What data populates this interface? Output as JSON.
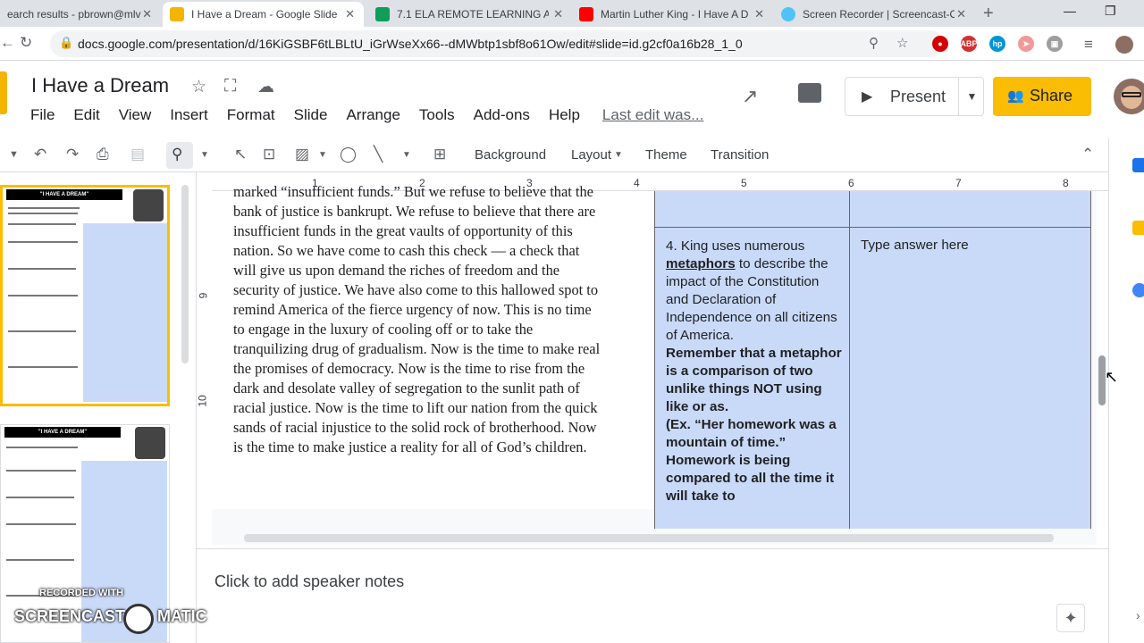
{
  "browser": {
    "tabs": [
      {
        "title": "earch results - pbrown@mlv",
        "color": "#1a73e8"
      },
      {
        "title": "I Have a Dream - Google Slide",
        "color": "#f4b400"
      },
      {
        "title": "7.1 ELA REMOTE LEARNING A",
        "color": "#0f9d58"
      },
      {
        "title": "Martin Luther King - I Have A D",
        "color": "#ff0000"
      },
      {
        "title": "Screen Recorder | Screencast-O",
        "color": "#4fc3f7"
      }
    ],
    "url": "docs.google.com/presentation/d/16KiGSBF6tLBLtU_iGrWseXx66--dMWbtp1sbf8o61Ow/edit#slide=id.g2cf0a16b28_1_0",
    "extensions": [
      "ABP",
      "hp"
    ]
  },
  "doc": {
    "title": "I Have a Dream",
    "menu": [
      "File",
      "Edit",
      "View",
      "Insert",
      "Format",
      "Slide",
      "Arrange",
      "Tools",
      "Add-ons",
      "Help"
    ],
    "last_edit": "Last edit was...",
    "present_label": "Present",
    "share_label": "Share"
  },
  "toolbar": {
    "background": "Background",
    "layout": "Layout",
    "theme": "Theme",
    "transition": "Transition"
  },
  "ruler": [
    "1",
    "2",
    "3",
    "4",
    "5",
    "6",
    "7",
    "8"
  ],
  "vruler": [
    "9",
    "10"
  ],
  "filmstrip": {
    "slide1_title": "\"I HAVE A DREAM\"",
    "slide2_title": "\"I HAVE A DREAM\""
  },
  "slide": {
    "speech": "marked “insufficient funds.” But we refuse to believe that the\nbank of justice is bankrupt. We refuse to believe that there are\ninsufficient funds in the great vaults of opportunity of this\nnation. So we have come to cash this check — a check that\nwill give us upon demand the riches of freedom and the\nsecurity of justice. We have also come to this hallowed spot to\nremind America of the fierce urgency of now. This is no time\nto engage in the luxury of cooling off or to take the\ntranquilizing drug of gradualism. Now is the time to make real\nthe promises of democracy. Now is the time to rise from the\ndark and desolate valley of segregation to the sunlit path of\nracial justice. Now is the time to lift our nation from the quick\nsands of racial injustice to the solid rock of brotherhood. Now\nis the time to make justice a reality for all of God’s children.",
    "question_pre": "4. King uses numerous",
    "question_keyword": "metaphors",
    "question_post": "to describe the impact of the Constitution and Declaration of Independence on all citizens of America.",
    "question_bold": "Remember that a metaphor is a comparison of two unlike things NOT using like or as.\n(Ex. “Her homework was a mountain of time.” Homework is being compared to all the time it will take to",
    "answer": "Type answer here"
  },
  "notes": {
    "placeholder": "Click to add speaker notes"
  },
  "watermark": {
    "line1": "RECORDED WITH",
    "line2": "SCREENCAST",
    "line3": "MATIC"
  }
}
